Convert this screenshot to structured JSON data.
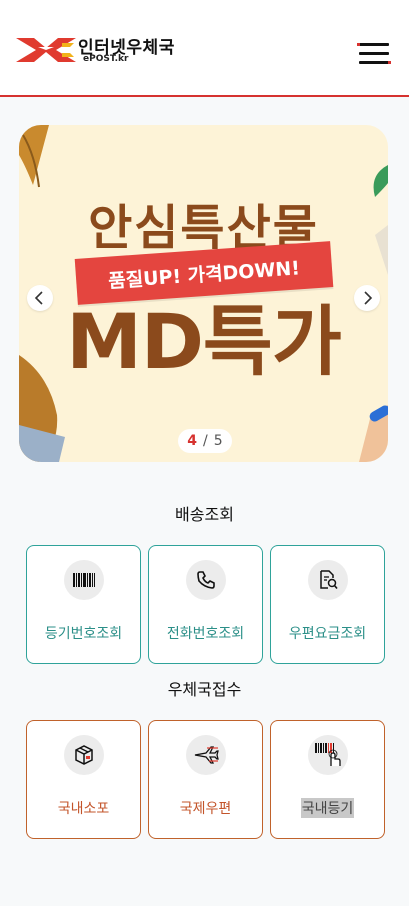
{
  "header": {
    "title": "인터넷우체국",
    "subtitle": "ePOST.kr",
    "logo_icon": "epost-logo-icon",
    "menu_icon": "hamburger-menu-icon",
    "accent_color": "#d6322f"
  },
  "banner": {
    "title": "안심특산물",
    "ribbon": "품질UP! 가격DOWN!",
    "headline": "MD특가",
    "current_slide": "4",
    "separator": "/",
    "total_slides": "5",
    "prev_icon": "chevron-left-icon",
    "next_icon": "chevron-right-icon"
  },
  "delivery": {
    "title": "배송조회",
    "items": [
      {
        "label": "등기번호조회",
        "icon": "barcode-icon"
      },
      {
        "label": "전화번호조회",
        "icon": "phone-icon"
      },
      {
        "label": "우편요금조회",
        "icon": "document-search-icon"
      }
    ],
    "border_color": "#2fa39a"
  },
  "reception": {
    "title": "우체국접수",
    "items": [
      {
        "label": "국내소포",
        "icon": "parcel-box-icon"
      },
      {
        "label": "국제우편",
        "icon": "airplane-mail-icon"
      },
      {
        "label": "국내등기",
        "icon": "barcode-touch-icon"
      }
    ],
    "border_color": "#c0622b"
  }
}
